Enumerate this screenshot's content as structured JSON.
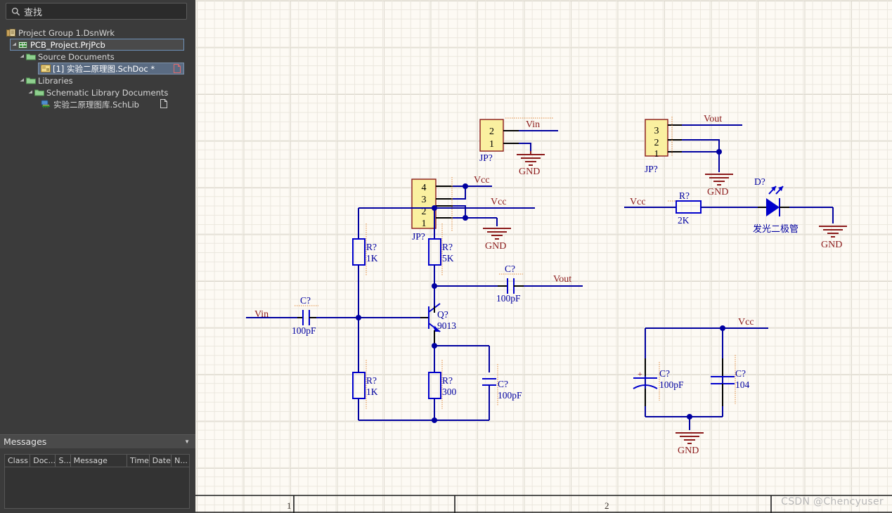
{
  "app": {
    "theme_bg": "#3b3b3b",
    "canvas_bg": "#fdfaf4",
    "wire_color": "#0000a0",
    "part_color": "#0000cc",
    "label_color": "#8b1a1a",
    "body_fill": "#faf0a0"
  },
  "search": {
    "placeholder": "查找",
    "value": "查找",
    "icon": "search-icon"
  },
  "tree": {
    "items": [
      {
        "label": "Project Group 1.DsnWrk",
        "indent": 0,
        "icon": "project-group-icon",
        "arrow": "",
        "state": "normal",
        "trailing": ""
      },
      {
        "label": "PCB_Project.PrjPcb",
        "indent": 1,
        "icon": "pcb-project-icon",
        "arrow": "▲",
        "state": "focused",
        "trailing": ""
      },
      {
        "label": "Source Documents",
        "indent": 2,
        "icon": "folder-icon",
        "arrow": "▲",
        "state": "normal",
        "trailing": ""
      },
      {
        "label": "[1] 实验二原理图.SchDoc *",
        "indent": 3,
        "icon": "schdoc-icon",
        "arrow": "",
        "state": "selected",
        "trailing": "document-icon"
      },
      {
        "label": "Libraries",
        "indent": 2,
        "icon": "folder-icon",
        "arrow": "▲",
        "state": "normal",
        "trailing": ""
      },
      {
        "label": "Schematic Library Documents",
        "indent": 3,
        "icon": "folder-icon",
        "arrow": "▲",
        "state": "normal",
        "trailing": ""
      },
      {
        "label": "实验二原理图库.SchLib",
        "indent": 4,
        "icon": "schlib-icon",
        "arrow": "",
        "state": "normal",
        "trailing": "document-icon"
      }
    ]
  },
  "messages": {
    "title": "Messages",
    "collapse_icon": "chevron-down-icon",
    "columns": [
      "Class",
      "Doc...",
      "S...",
      "Message",
      "Time",
      "Date",
      "N..."
    ],
    "rows": []
  },
  "sheet": {
    "zones": [
      "1",
      "2"
    ],
    "watermark": "CSDN @Chencyuser"
  },
  "schematic": {
    "connectors": [
      {
        "id": "jp-top-vin",
        "designator": "JP?",
        "pins": [
          "2",
          "1"
        ],
        "nets": [
          "Vin",
          "GND"
        ]
      },
      {
        "id": "jp-left-vcc",
        "designator": "JP?",
        "pins": [
          "4",
          "3",
          "2",
          "1"
        ],
        "nets": [
          "Vcc",
          "GND"
        ]
      },
      {
        "id": "jp-top-vout",
        "designator": "JP?",
        "pins": [
          "3",
          "2",
          "1"
        ],
        "nets": [
          "Vout",
          "GND"
        ]
      }
    ],
    "resistors": [
      {
        "id": "r-1k-upper",
        "designator": "R?",
        "value": "1K"
      },
      {
        "id": "r-5k",
        "designator": "R?",
        "value": "5K"
      },
      {
        "id": "r-1k-lower",
        "designator": "R?",
        "value": "1K"
      },
      {
        "id": "r-300",
        "designator": "R?",
        "value": "300"
      },
      {
        "id": "r-2k",
        "designator": "R?",
        "value": "2K"
      }
    ],
    "capacitors": [
      {
        "id": "c-vin",
        "designator": "C?",
        "value": "100pF",
        "polarized": false
      },
      {
        "id": "c-vout",
        "designator": "C?",
        "value": "100pF",
        "polarized": false
      },
      {
        "id": "c-emitter",
        "designator": "C?",
        "value": "100pF",
        "polarized": false
      },
      {
        "id": "c-bulk",
        "designator": "C?",
        "value": "100pF",
        "polarized": true
      },
      {
        "id": "c-104",
        "designator": "C?",
        "value": "104",
        "polarized": false
      }
    ],
    "transistor": {
      "id": "q1",
      "designator": "Q?",
      "value": "9013",
      "type": "NPN"
    },
    "diode": {
      "id": "d1",
      "designator": "D?",
      "value": "发光二极管",
      "type": "LED"
    },
    "net_labels": {
      "vin": "Vin",
      "vout": "Vout",
      "vcc": "Vcc",
      "gnd": "GND"
    }
  }
}
